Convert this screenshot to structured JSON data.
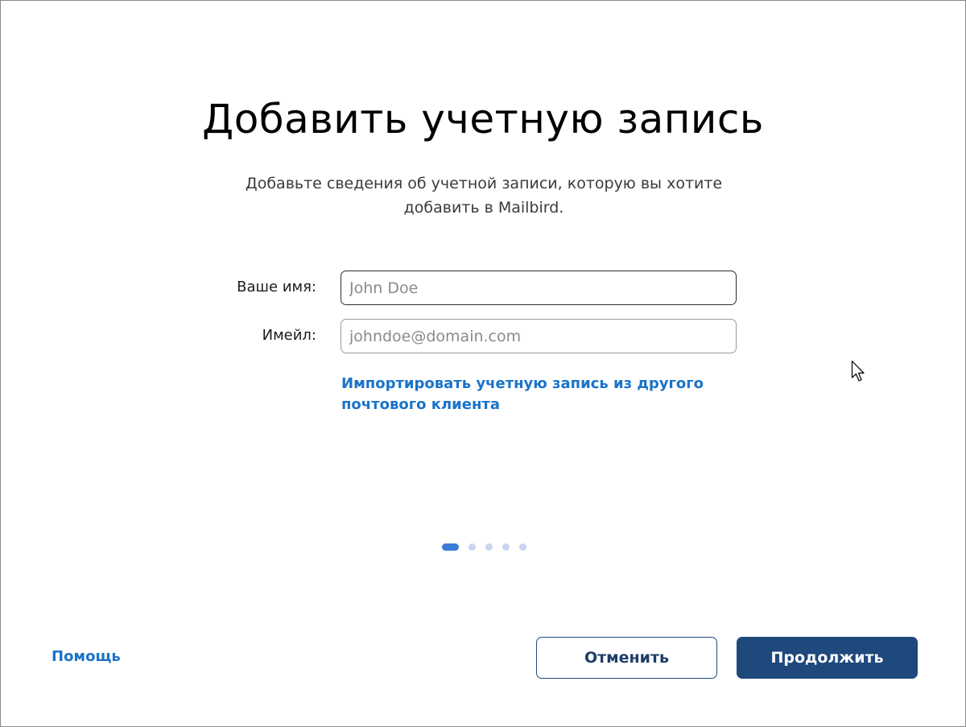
{
  "dialog": {
    "title": "Добавить учетную запись",
    "subtitle": "Добавьте сведения об учетной записи, которую вы хотите добавить в Mailbird."
  },
  "form": {
    "name_label": "Ваше имя:",
    "name_value": "",
    "name_placeholder": "John Doe",
    "email_label": "Имейл:",
    "email_value": "",
    "email_placeholder": "johndoe@domain.com"
  },
  "import_link": "Импортировать учетную запись из другого почтового клиента",
  "pager": {
    "total_steps": 5,
    "current_step": 1
  },
  "footer": {
    "help_label": "Помощь",
    "cancel_label": "Отменить",
    "continue_label": "Продолжить"
  },
  "colors": {
    "link": "#1a73c8",
    "primary_button": "#1f487d",
    "pager_active": "#3a7bd5",
    "pager_inactive": "#c7d6ee"
  },
  "icons": {
    "cursor": "mouse-pointer-icon"
  }
}
